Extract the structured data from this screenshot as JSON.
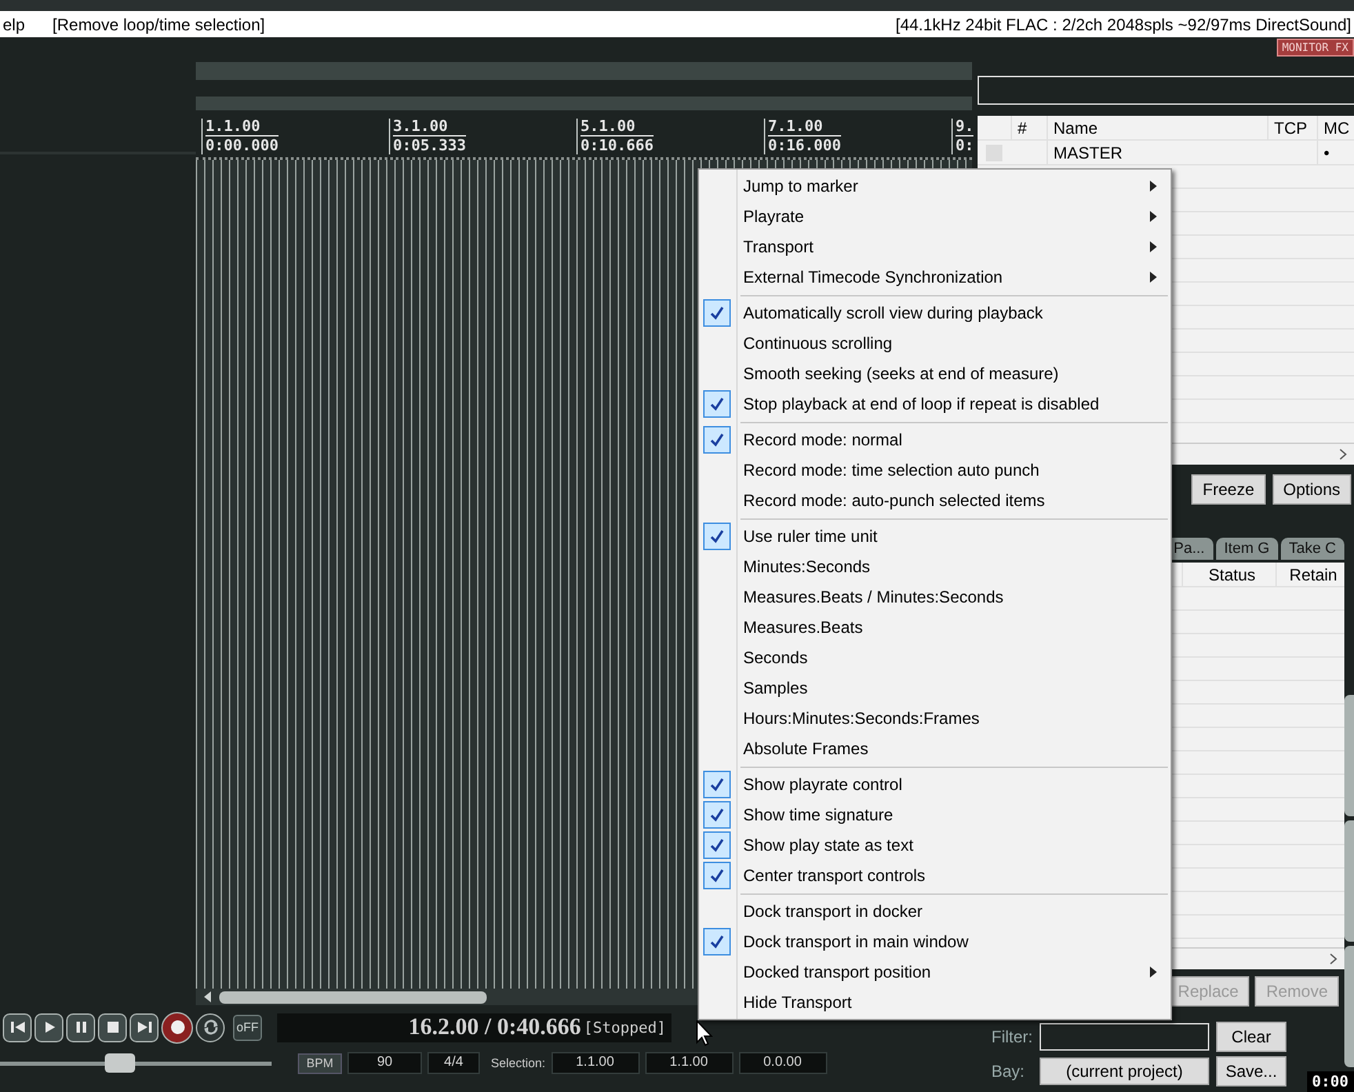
{
  "menu_bar": {
    "menu_item": "elp",
    "action_hint": "[Remove loop/time selection]",
    "audio_status": "[44.1kHz 24bit FLAC : 2/2ch 2048spls ~92/97ms DirectSound]"
  },
  "ruler": {
    "markers": [
      {
        "measure": "1.1.00",
        "time": "0:00.000"
      },
      {
        "measure": "3.1.00",
        "time": "0:05.333"
      },
      {
        "measure": "5.1.00",
        "time": "0:10.666"
      },
      {
        "measure": "7.1.00",
        "time": "0:16.000"
      },
      {
        "measure": "9.",
        "time": "0:"
      }
    ]
  },
  "transport": {
    "buttons": [
      {
        "kind": "go-start"
      },
      {
        "kind": "play"
      },
      {
        "kind": "pause"
      },
      {
        "kind": "stop"
      },
      {
        "kind": "go-end"
      },
      {
        "kind": "record"
      },
      {
        "kind": "repeat"
      }
    ],
    "off_toggle": "oFF",
    "position": "16.2.00 / 0:40.666",
    "play_state": "[Stopped]",
    "playrate": {
      "level": 0.44
    },
    "bpm_label": "BPM",
    "bpm": "90",
    "time_signature": "4/4",
    "selection_label": "Selection:",
    "selection": [
      "1.1.00",
      "1.1.00",
      "0.0.00"
    ]
  },
  "docker": {
    "monitor_fx": "MONITOR FX",
    "track_table": {
      "columns": [
        "#",
        "Name",
        "TCP",
        "MC"
      ],
      "rows": [
        {
          "name": "MASTER",
          "mc": "•"
        }
      ]
    },
    "track_buttons": [
      "Freeze",
      "Options"
    ],
    "tabs": [
      {
        "label": "Pa...",
        "selected": false
      },
      {
        "label": "Item G",
        "selected": false
      },
      {
        "label": "Take C",
        "selected": false
      }
    ],
    "bay_table": {
      "columns": [
        "Status",
        "Retain"
      ]
    },
    "bay_buttons": [
      {
        "label": "Replace",
        "disabled": true
      },
      {
        "label": "Remove",
        "disabled": true
      }
    ],
    "filter_label": "Filter:",
    "clear_button": "Clear",
    "bay_label": "Bay:",
    "bay_select": "(current project)",
    "save_button": "Save...",
    "time_display": "0:00"
  },
  "context_menu": {
    "groups": [
      {
        "items": [
          {
            "label": "Jump to marker",
            "checked": false,
            "submenu": true
          },
          {
            "label": "Playrate",
            "checked": false,
            "submenu": true
          },
          {
            "label": "Transport",
            "checked": false,
            "submenu": true
          },
          {
            "label": "External Timecode Synchronization",
            "checked": false,
            "submenu": true
          }
        ]
      },
      {
        "items": [
          {
            "label": "Automatically scroll view during playback",
            "checked": true,
            "submenu": false
          },
          {
            "label": "Continuous scrolling",
            "checked": false,
            "submenu": false
          },
          {
            "label": "Smooth seeking (seeks at end of measure)",
            "checked": false,
            "submenu": false
          },
          {
            "label": "Stop playback at end of loop if repeat is disabled",
            "checked": true,
            "submenu": false
          }
        ]
      },
      {
        "items": [
          {
            "label": "Record mode: normal",
            "checked": true,
            "submenu": false
          },
          {
            "label": "Record mode: time selection auto punch",
            "checked": false,
            "submenu": false
          },
          {
            "label": "Record mode: auto-punch selected items",
            "checked": false,
            "submenu": false
          }
        ]
      },
      {
        "items": [
          {
            "label": "Use ruler time unit",
            "checked": true,
            "submenu": false
          },
          {
            "label": "Minutes:Seconds",
            "checked": false,
            "submenu": false
          },
          {
            "label": "Measures.Beats / Minutes:Seconds",
            "checked": false,
            "submenu": false
          },
          {
            "label": "Measures.Beats",
            "checked": false,
            "submenu": false
          },
          {
            "label": "Seconds",
            "checked": false,
            "submenu": false
          },
          {
            "label": "Samples",
            "checked": false,
            "submenu": false
          },
          {
            "label": "Hours:Minutes:Seconds:Frames",
            "checked": false,
            "submenu": false
          },
          {
            "label": "Absolute Frames",
            "checked": false,
            "submenu": false
          }
        ]
      },
      {
        "items": [
          {
            "label": "Show playrate control",
            "checked": true,
            "submenu": false
          },
          {
            "label": "Show time signature",
            "checked": true,
            "submenu": false
          },
          {
            "label": "Show play state as text",
            "checked": true,
            "submenu": false
          },
          {
            "label": "Center transport controls",
            "checked": true,
            "submenu": false
          }
        ]
      },
      {
        "items": [
          {
            "label": "Dock transport in docker",
            "checked": false,
            "submenu": false
          },
          {
            "label": "Dock transport in main window",
            "checked": true,
            "submenu": false
          },
          {
            "label": "Docked transport position",
            "checked": false,
            "submenu": true
          },
          {
            "label": "Hide Transport",
            "checked": false,
            "submenu": false
          }
        ]
      }
    ]
  }
}
